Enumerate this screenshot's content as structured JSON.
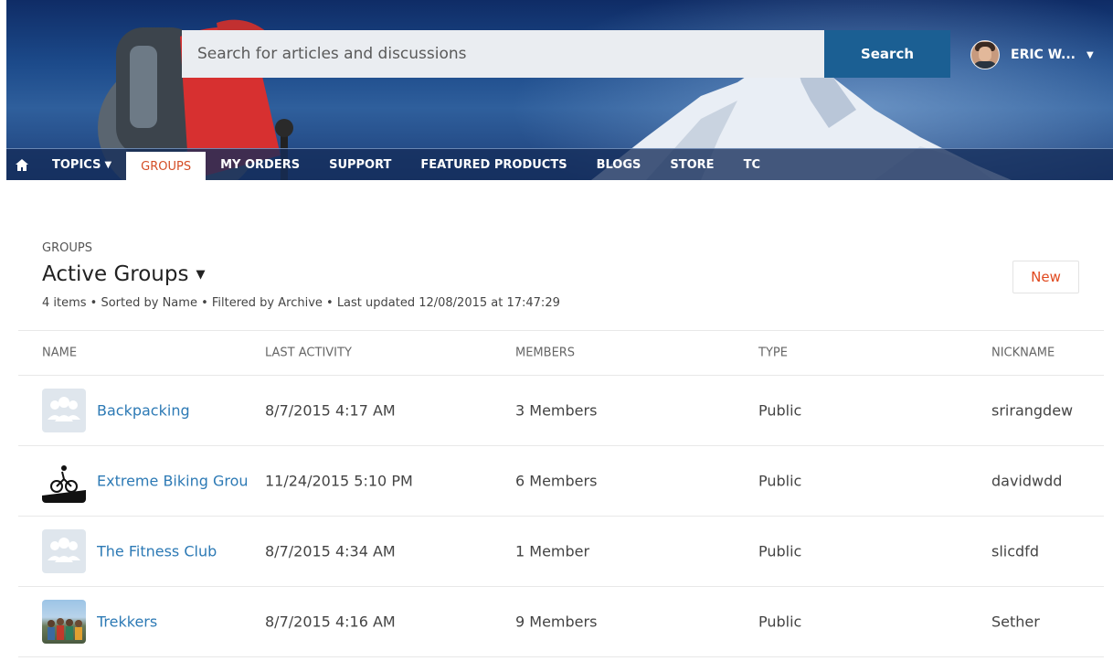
{
  "header": {
    "search": {
      "placeholder": "Search for articles and discussions",
      "button_label": "Search"
    },
    "user": {
      "name": "ERIC W...",
      "caret": "▼"
    }
  },
  "nav": {
    "home_icon": "home-icon",
    "items": [
      {
        "label": "TOPICS",
        "has_dropdown": true,
        "caret": "▼"
      },
      {
        "label": "GROUPS",
        "active": true
      },
      {
        "label": "MY ORDERS"
      },
      {
        "label": "SUPPORT"
      },
      {
        "label": "FEATURED PRODUCTS"
      },
      {
        "label": "BLOGS"
      },
      {
        "label": "STORE"
      },
      {
        "label": "TC"
      }
    ]
  },
  "page": {
    "breadcrumb": "GROUPS",
    "title": "Active Groups",
    "title_caret": "▼",
    "meta": "4 items • Sorted by Name • Filtered by Archive • Last updated 12/08/2015  at 17:47:29",
    "new_button": "New"
  },
  "table": {
    "columns": [
      "NAME",
      "LAST ACTIVITY",
      "MEMBERS",
      "TYPE",
      "NICKNAME"
    ],
    "rows": [
      {
        "icon": "group-default-icon",
        "name": "Backpacking",
        "last_activity": "8/7/2015 4:17 AM",
        "members": "3 Members",
        "type": "Public",
        "nickname": "srirangdew"
      },
      {
        "icon": "biking-group-icon",
        "name": "Extreme Biking Grou",
        "last_activity": "11/24/2015 5:10 PM",
        "members": "6 Members",
        "type": "Public",
        "nickname": "davidwdd"
      },
      {
        "icon": "group-default-icon",
        "name": "The Fitness Club",
        "last_activity": "8/7/2015 4:34 AM",
        "members": "1 Member",
        "type": "Public",
        "nickname": "slicdfd"
      },
      {
        "icon": "group-photo-icon",
        "name": "Trekkers",
        "last_activity": "8/7/2015 4:16 AM",
        "members": "9 Members",
        "type": "Public",
        "nickname": "Sether"
      }
    ]
  },
  "colors": {
    "link": "#2d7ab5",
    "accent": "#e0491f",
    "search_button": "#1b5f93",
    "header_bg": "#1c4a8a"
  }
}
